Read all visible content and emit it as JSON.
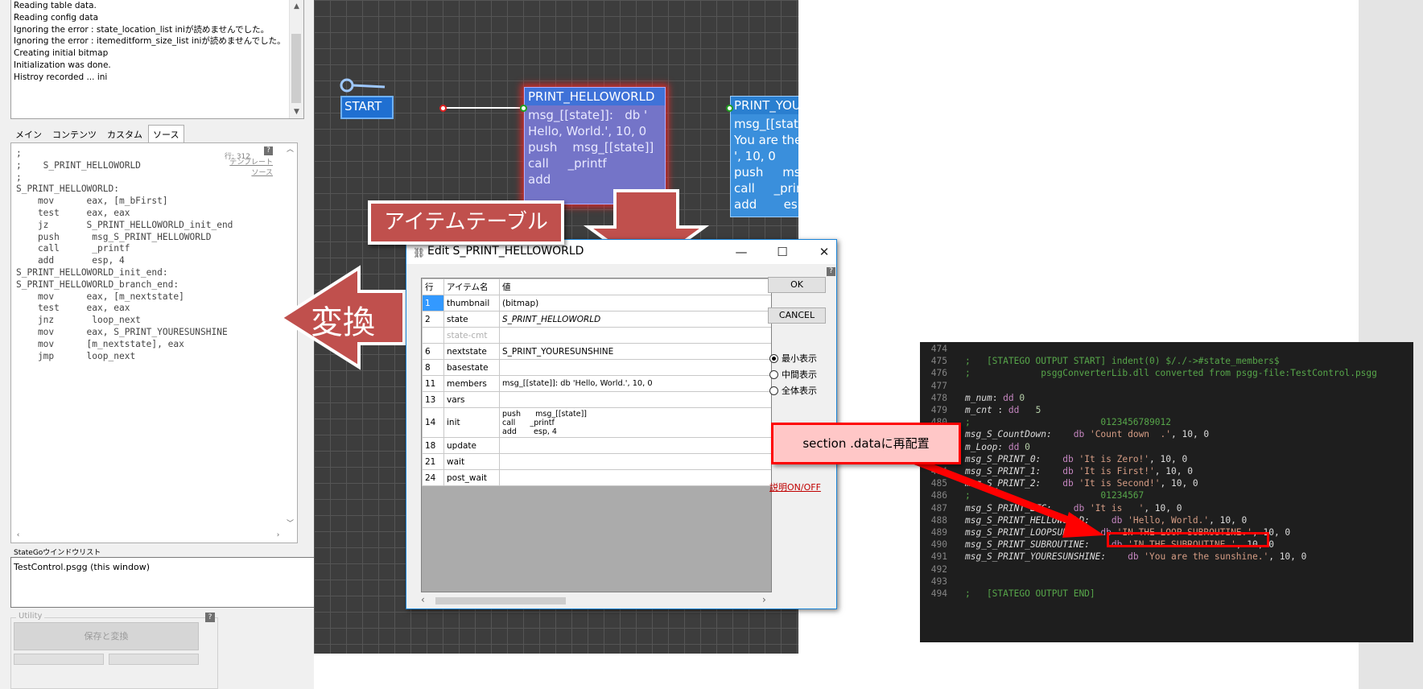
{
  "log": {
    "lines": [
      "Reading table data.",
      "Reading config data",
      "Ignoring the error : state_location_list iniが読めませんでした。",
      "Ignoring the error : itemeditform_size_list iniが読めませんでした。",
      "Creating initial bitmap",
      "Initialization was done.",
      "Histroy recorded ... ini"
    ]
  },
  "tabs": [
    "メイン",
    "コンテンツ",
    "カスタム",
    "ソース"
  ],
  "source": {
    "line_info": "行: 312",
    "help": "?",
    "links": [
      "テンプレート",
      "ソース"
    ],
    "code": ";\n;    S_PRINT_HELLOWORLD\n;\nS_PRINT_HELLOWORLD:\n    mov      eax, [m_bFirst]\n    test     eax, eax\n    jz       S_PRINT_HELLOWORLD_init_end\n    push      msg_S_PRINT_HELLOWORLD\n    call      _printf\n    add       esp, 4\nS_PRINT_HELLOWORLD_init_end:\nS_PRINT_HELLOWORLD_branch_end:\n    mov      eax, [m_nextstate]\n    test     eax, eax\n    jnz       loop_next\n    mov      eax, S_PRINT_YOURESUNSHINE\n    mov      [m_nextstate], eax\n    jmp      loop_next"
  },
  "state_window": {
    "label": "StateGoウインドウリスト",
    "item": "TestControl.psgg (this window)"
  },
  "utility": {
    "label": "Utility",
    "help": "?",
    "save_convert": "保存と変換"
  },
  "canvas": {
    "start_label": "START",
    "node1": {
      "title": "PRINT_HELLOWORLD",
      "body": "msg_[[state]]:   db '\nHello, World.', 10, 0\npush    msg_[[state]]\ncall     _printf\nadd"
    },
    "node2": {
      "title": "PRINT_YOURE",
      "body": "msg_[[state_\nYou are the\n', 10, 0\npush     ms\ncall     _prin\nadd       esp"
    }
  },
  "callouts": {
    "item_table": "アイテムテーブル",
    "convert": "変換",
    "relocate": "section .dataに再配置"
  },
  "dialog": {
    "title": "Edit S_PRINT_HELLOWORLD",
    "headers": [
      "行",
      "アイテム名",
      "値"
    ],
    "rows": [
      {
        "n": "1",
        "name": "thumbnail",
        "value": "(bitmap)"
      },
      {
        "n": "2",
        "name": "state",
        "value": "S_PRINT_HELLOWORLD"
      },
      {
        "n": "",
        "name": "state-cmt",
        "value": ""
      },
      {
        "n": "6",
        "name": "nextstate",
        "value": "S_PRINT_YOURESUNSHINE"
      },
      {
        "n": "8",
        "name": "basestate",
        "value": ""
      },
      {
        "n": "11",
        "name": "members",
        "value": "msg_[[state]]:    db 'Hello, World.', 10, 0"
      },
      {
        "n": "13",
        "name": "vars",
        "value": ""
      },
      {
        "n": "14",
        "name": "init",
        "value": "push      msg_[[state]]\ncall      _printf\nadd       esp, 4"
      },
      {
        "n": "18",
        "name": "update",
        "value": ""
      },
      {
        "n": "21",
        "name": "wait",
        "value": ""
      },
      {
        "n": "24",
        "name": "post_wait",
        "value": ""
      }
    ],
    "ok": "OK",
    "cancel": "CANCEL",
    "radios": [
      "最小表示",
      "中間表示",
      "全体表示"
    ],
    "selected_radio": 0,
    "explain_toggle": "説明ON/OFF",
    "help": "?"
  },
  "output": {
    "lines": [
      {
        "ln": "474",
        "parts": []
      },
      {
        "ln": "475",
        "parts": [
          {
            "c": "c-com",
            "t": ";   [STATEGO OUTPUT START] indent(0) $/./->#state_members$"
          }
        ]
      },
      {
        "ln": "476",
        "parts": [
          {
            "c": "c-com",
            "t": ";             psggConverterLib.dll converted from psgg-file:TestControl.psgg"
          }
        ]
      },
      {
        "ln": "477",
        "parts": []
      },
      {
        "ln": "478",
        "parts": [
          {
            "c": "c-lbl",
            "t": "m_num"
          },
          {
            "c": "",
            "t": ": "
          },
          {
            "c": "c-kw",
            "t": "dd"
          },
          {
            "c": "c-num",
            "t": " 0"
          }
        ]
      },
      {
        "ln": "479",
        "parts": [
          {
            "c": "c-lbl",
            "t": "m_cnt"
          },
          {
            "c": "",
            "t": " : "
          },
          {
            "c": "c-kw",
            "t": "dd"
          },
          {
            "c": "c-num",
            "t": "   5"
          }
        ]
      },
      {
        "ln": "480",
        "parts": [
          {
            "c": "c-com",
            "t": ";                        0123456789012"
          }
        ]
      },
      {
        "ln": "481",
        "parts": [
          {
            "c": "c-lbl",
            "t": "msg_S_CountDown:"
          },
          {
            "c": "",
            "t": "    "
          },
          {
            "c": "c-kw",
            "t": "db"
          },
          {
            "c": "c-str",
            "t": " 'Count down  .'"
          },
          {
            "c": "",
            "t": ", 10, 0"
          }
        ]
      },
      {
        "ln": "482",
        "parts": [
          {
            "c": "c-lbl",
            "t": "m_Loop:"
          },
          {
            "c": "",
            "t": " "
          },
          {
            "c": "c-kw",
            "t": "dd"
          },
          {
            "c": "c-num",
            "t": " 0"
          }
        ]
      },
      {
        "ln": "483",
        "parts": [
          {
            "c": "c-lbl",
            "t": "msg_S_PRINT_0:"
          },
          {
            "c": "",
            "t": "    "
          },
          {
            "c": "c-kw",
            "t": "db"
          },
          {
            "c": "c-str",
            "t": " 'It is Zero!'"
          },
          {
            "c": "",
            "t": ", 10, 0"
          }
        ]
      },
      {
        "ln": "484",
        "parts": [
          {
            "c": "c-lbl",
            "t": "msg_S_PRINT_1:"
          },
          {
            "c": "",
            "t": "    "
          },
          {
            "c": "c-kw",
            "t": "db"
          },
          {
            "c": "c-str",
            "t": " 'It is First!'"
          },
          {
            "c": "",
            "t": ", 10, 0"
          }
        ]
      },
      {
        "ln": "485",
        "parts": [
          {
            "c": "c-lbl",
            "t": "msg_S_PRINT_2:"
          },
          {
            "c": "",
            "t": "    "
          },
          {
            "c": "c-kw",
            "t": "db"
          },
          {
            "c": "c-str",
            "t": " 'It is Second!'"
          },
          {
            "c": "",
            "t": ", 10, 0"
          }
        ]
      },
      {
        "ln": "486",
        "parts": [
          {
            "c": "c-com",
            "t": ";                        01234567"
          }
        ]
      },
      {
        "ln": "487",
        "parts": [
          {
            "c": "c-lbl",
            "t": "msg_S_PRINT_ETC:"
          },
          {
            "c": "",
            "t": "    "
          },
          {
            "c": "c-kw",
            "t": "db"
          },
          {
            "c": "c-str",
            "t": " 'It is   '"
          },
          {
            "c": "",
            "t": ", 10, 0"
          }
        ]
      },
      {
        "ln": "488",
        "parts": [
          {
            "c": "c-lbl",
            "t": "msg_S_PRINT_HELLOWORLD:"
          },
          {
            "c": "",
            "t": "    "
          },
          {
            "c": "c-kw",
            "t": "db"
          },
          {
            "c": "c-str",
            "t": " 'Hello, World.'"
          },
          {
            "c": "",
            "t": ", 10, 0"
          }
        ]
      },
      {
        "ln": "489",
        "parts": [
          {
            "c": "c-lbl",
            "t": "msg_S_PRINT_LOOPSUB1:"
          },
          {
            "c": "",
            "t": "    "
          },
          {
            "c": "c-kw",
            "t": "db"
          },
          {
            "c": "c-str",
            "t": " 'IN THE LOOP SUBROUTINE.'"
          },
          {
            "c": "",
            "t": ", 10, 0"
          }
        ]
      },
      {
        "ln": "490",
        "parts": [
          {
            "c": "c-lbl",
            "t": "msg_S_PRINT_SUBROUTINE:"
          },
          {
            "c": "",
            "t": "    "
          },
          {
            "c": "c-kw",
            "t": "db"
          },
          {
            "c": "c-str",
            "t": " 'IN THE SUBROUTINE.'"
          },
          {
            "c": "",
            "t": ", 10, 0"
          }
        ]
      },
      {
        "ln": "491",
        "parts": [
          {
            "c": "c-lbl",
            "t": "msg_S_PRINT_YOURESUNSHINE:"
          },
          {
            "c": "",
            "t": "    "
          },
          {
            "c": "c-kw",
            "t": "db"
          },
          {
            "c": "c-str",
            "t": " 'You are the sunshine.'"
          },
          {
            "c": "",
            "t": ", 10, 0"
          }
        ]
      },
      {
        "ln": "492",
        "parts": []
      },
      {
        "ln": "493",
        "parts": []
      },
      {
        "ln": "494",
        "parts": [
          {
            "c": "c-com",
            "t": ";   [STATEGO OUTPUT END]"
          }
        ]
      }
    ]
  },
  "colors": {
    "node_selected": "#6f6fc4",
    "node_normal": "#3a8fdc",
    "start_node": "#1f6fd1",
    "callout_red": "#c0504d",
    "arrow_red": "#ff0000"
  }
}
